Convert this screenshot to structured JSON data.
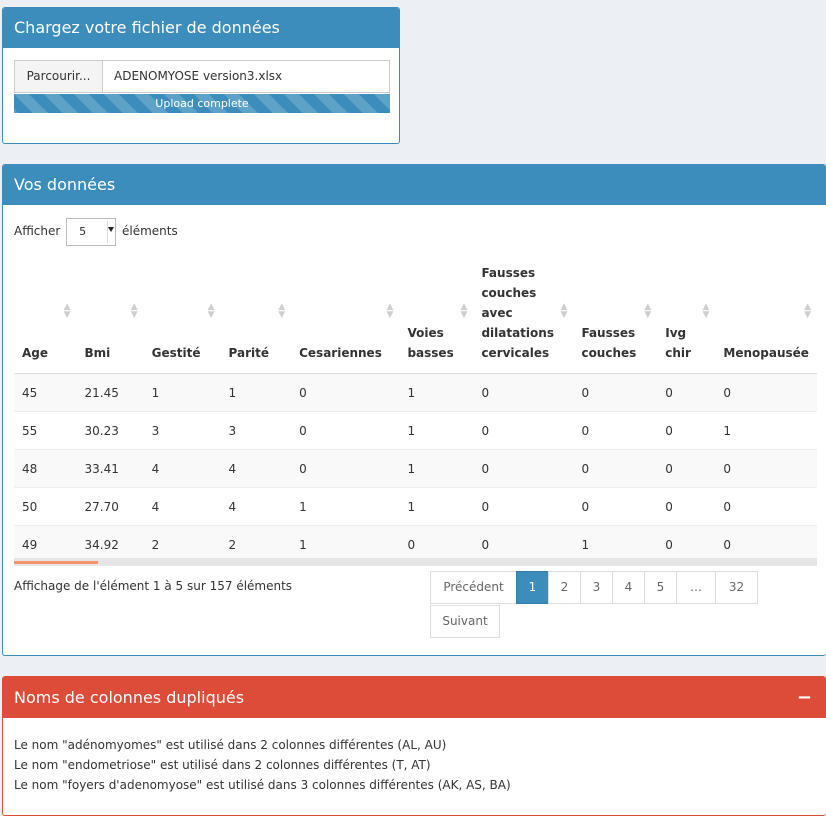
{
  "upload": {
    "title": "Chargez votre fichier de données",
    "browse_label": "Parcourir...",
    "file_name": "ADENOMYOSE version3.xlsx",
    "progress_text": "Upload complete",
    "progress_fraction": 1.0,
    "accent": "#3c8dbc"
  },
  "data_panel": {
    "title": "Vos données",
    "length_label_before": "Afficher",
    "length_value": "5",
    "length_label_after": "éléments",
    "columns": [
      "Age",
      "Bmi",
      "Gestité",
      "Parité",
      "Cesariennes",
      "Voies basses",
      "Fausses couches avec dilatations cervicales",
      "Fausses couches",
      "Ivg chir",
      "Menopausée"
    ],
    "rows": [
      [
        "45",
        "21.45",
        "1",
        "1",
        "0",
        "1",
        "0",
        "0",
        "0",
        "0"
      ],
      [
        "55",
        "30.23",
        "3",
        "3",
        "0",
        "1",
        "0",
        "0",
        "0",
        "1"
      ],
      [
        "48",
        "33.41",
        "4",
        "4",
        "0",
        "1",
        "0",
        "0",
        "0",
        "0"
      ],
      [
        "50",
        "27.70",
        "4",
        "4",
        "1",
        "1",
        "0",
        "0",
        "0",
        "0"
      ],
      [
        "49",
        "34.92",
        "2",
        "2",
        "1",
        "0",
        "0",
        "1",
        "0",
        "0"
      ]
    ],
    "info": "Affichage de l'élément 1 à 5 sur 157 éléments",
    "pagination": {
      "previous": "Précédent",
      "pages": [
        "1",
        "2",
        "3",
        "4",
        "5",
        "…",
        "32"
      ],
      "active": "1",
      "next": "Suivant"
    }
  },
  "duplicates": {
    "title": "Noms de colonnes dupliqués",
    "collapse_symbol": "−",
    "accent": "#dd4b39",
    "lines": [
      "Le nom \"adénomyomes\" est utilisé dans 2 colonnes différentes (AL, AU)",
      "Le nom \"endometriose\" est utilisé dans 2 colonnes différentes (T, AT)",
      "Le nom \"foyers d'adenomyose\" est utilisé dans 3 colonnes différentes (AK, AS, BA)"
    ]
  }
}
